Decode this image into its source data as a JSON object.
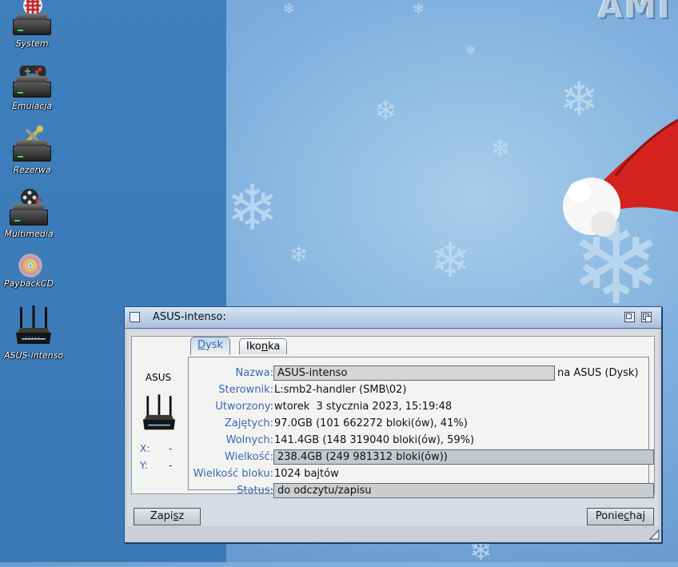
{
  "desktop": {
    "icons": [
      {
        "label": "System",
        "icon": "system-drive-icon"
      },
      {
        "label": "Emulacja",
        "icon": "gamepad-drive-icon"
      },
      {
        "label": "Rezerwa",
        "icon": "tools-drive-icon"
      },
      {
        "label": "Multimedia",
        "icon": "multimedia-drive-icon"
      },
      {
        "label": "PaybackCD",
        "icon": "cd-icon"
      },
      {
        "label": "ASUS-intenso",
        "icon": "router-icon"
      }
    ]
  },
  "window": {
    "title": "ASUS-intenso:",
    "volume_label": "ASUS",
    "x_label": "X:",
    "x_value": "-",
    "y_label": "Y:",
    "y_value": "-",
    "tabs": [
      {
        "label_pre": "",
        "label_u": "D",
        "label_post": "ysk",
        "active": true
      },
      {
        "label_pre": "Iko",
        "label_u": "n",
        "label_post": "ka",
        "active": false
      }
    ],
    "fields": {
      "name_label": "Nazwa:",
      "name_value": "ASUS-intenso",
      "name_suffix": "na ASUS (Dysk)",
      "driver_label": "Sterownik:",
      "driver_value": "L:smb2-handler (SMB\\02)",
      "created_label": "Utworzony:",
      "created_value": "wtorek  3 stycznia 2023, 15:19:48",
      "used_label": "Zajętych:",
      "used_value": "97.0GB (101 662272 bloki(ów), 41%)",
      "free_label": "Wolnych:",
      "free_value": "141.4GB (148 319040 bloki(ów), 59%)",
      "size_label": "Wielkość:",
      "size_value": "238.4GB (249 981312 bloki(ów))",
      "block_label": "Wielkość bloku:",
      "block_value": "1024 bajtów",
      "status_label": "Status:",
      "status_value": "do odczytu/zapisu"
    },
    "save_pre": "Zapi",
    "save_u": "s",
    "save_post": "z",
    "cancel_pre": "Ponie",
    "cancel_u": "c",
    "cancel_post": "haj"
  },
  "colors": {
    "label_blue": "#3a68b4",
    "desktop_blue": "#3f7fbd",
    "hat_red": "#d4231f"
  }
}
